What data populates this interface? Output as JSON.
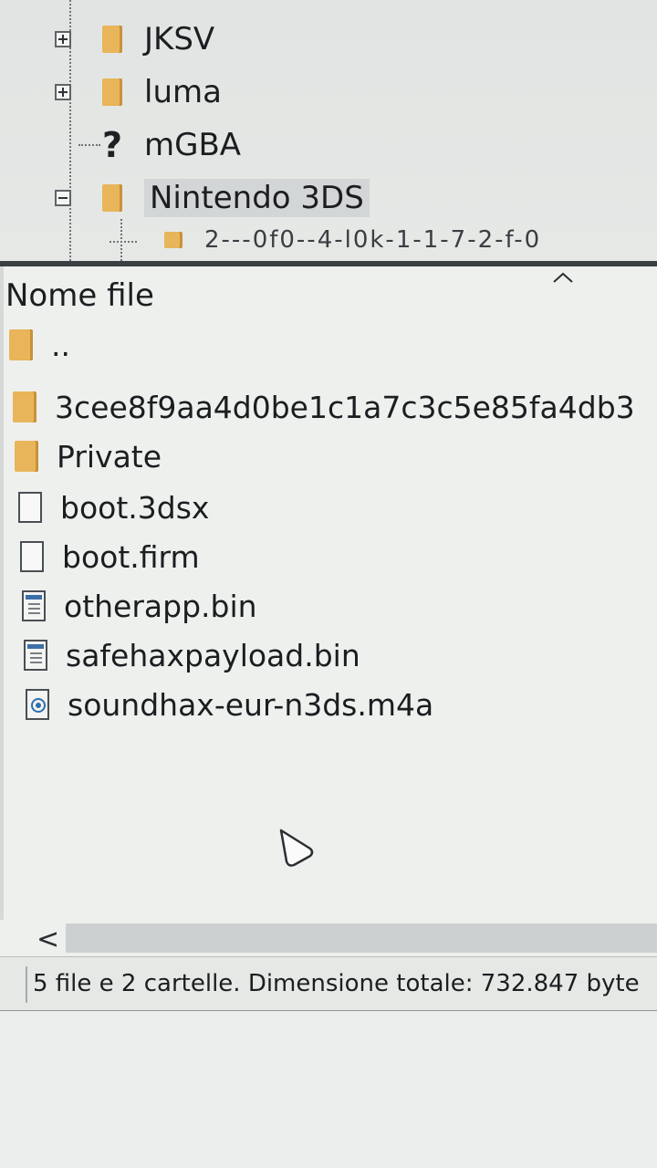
{
  "tree": {
    "nodes": [
      {
        "label": "JKSV",
        "toggle": "plus",
        "icon": "folder"
      },
      {
        "label": "luma",
        "toggle": "plus",
        "icon": "folder"
      },
      {
        "label": "mGBA",
        "toggle": "none",
        "icon": "question-mark"
      },
      {
        "label": "Nintendo 3DS",
        "toggle": "minus",
        "icon": "folder",
        "selected": true
      }
    ],
    "partial_label": "2---0f0--4-l0k-1-1-7-2-f-0"
  },
  "list": {
    "column_header": "Nome file",
    "items": [
      {
        "name": "..",
        "icon": "folder"
      },
      {
        "name": "3cee8f9aa4d0be1c1a7c3c5e85fa4db3",
        "icon": "folder"
      },
      {
        "name": "Private",
        "icon": "folder"
      },
      {
        "name": "boot.3dsx",
        "icon": "blank-file"
      },
      {
        "name": "boot.firm",
        "icon": "blank-file"
      },
      {
        "name": "otherapp.bin",
        "icon": "binary-file"
      },
      {
        "name": "safehaxpayload.bin",
        "icon": "binary-file"
      },
      {
        "name": "soundhax-eur-n3ds.m4a",
        "icon": "media-file"
      }
    ]
  },
  "scrollbar": {
    "left_arrow": "<"
  },
  "status": {
    "text": "5 file e 2 cartelle. Dimensione totale: 732.847 byte"
  },
  "colors": {
    "folder": "#e8b55a",
    "accent": "#2e6fb0"
  }
}
